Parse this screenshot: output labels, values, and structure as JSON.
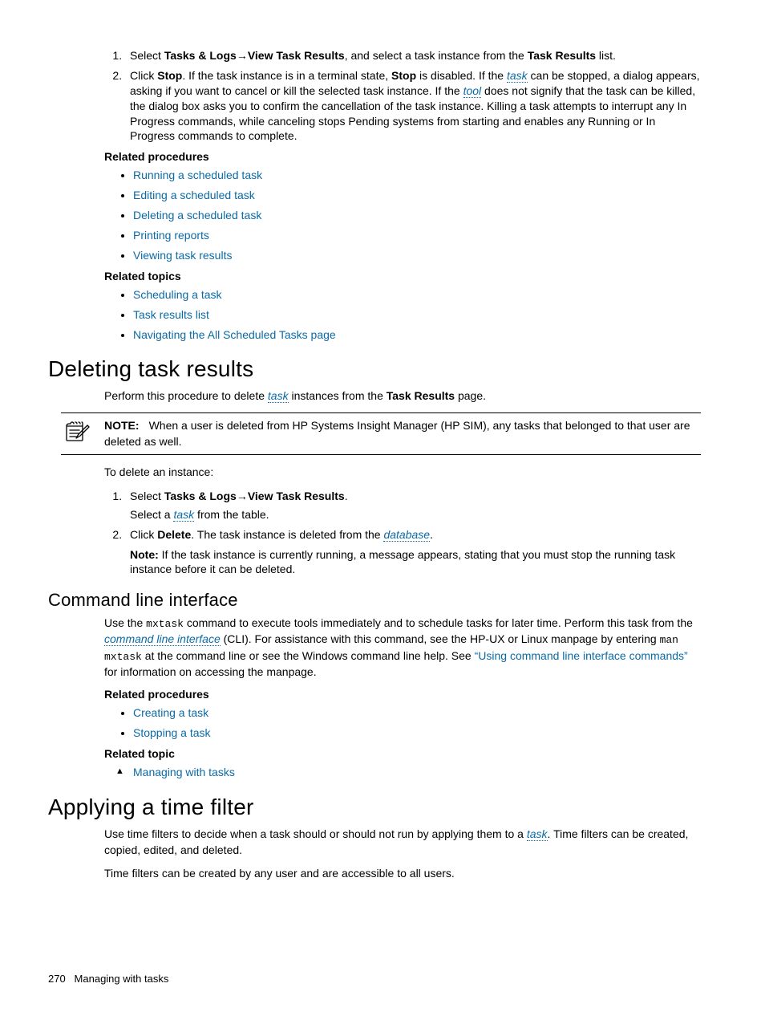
{
  "ol1": {
    "item1": {
      "pre": "Select ",
      "b1": "Tasks & Logs",
      "arrow": "→",
      "b2": "View Task Results",
      "mid": ", and select a task instance from the ",
      "b3": "Task Results",
      "post": " list."
    },
    "item2": {
      "t1": "Click ",
      "b1": "Stop",
      "t2": ". If the task instance is in a terminal state, ",
      "b2": "Stop",
      "t3": " is disabled. If the ",
      "l1": "task",
      "t4": " can be stopped, a dialog appears, asking if you want to cancel or kill the selected task instance. If the ",
      "l2": "tool",
      "t5": " does not signify that the task can be killed, the dialog box asks you to confirm the cancellation of the task instance. Killing a task attempts to interrupt any In Progress commands, while canceling stops Pending systems from starting and enables any Running or In Progress commands to complete."
    }
  },
  "relproc1_head": "Related procedures",
  "relproc1": {
    "i1": "Running a scheduled task",
    "i2": "Editing a scheduled task",
    "i3": "Deleting a scheduled task",
    "i4": "Printing reports",
    "i5": "Viewing task results"
  },
  "reltopics1_head": "Related topics",
  "reltopics1": {
    "i1": "Scheduling a task",
    "i2": "Task results list",
    "i3": "Navigating the All Scheduled Tasks page"
  },
  "sec_del_title": "Deleting task results",
  "sec_del_intro": {
    "t1": "Perform this procedure to delete ",
    "l1": "task",
    "t2": " instances from the ",
    "b1": "Task Results",
    "t3": " page."
  },
  "note1": {
    "label": "NOTE:",
    "text": "When a user is deleted from HP Systems Insight Manager (HP SIM), any tasks that belonged to that user are deleted as well."
  },
  "del_pre": "To delete an instance:",
  "ol2": {
    "item1": {
      "line1": {
        "t1": "Select ",
        "b1": "Tasks & Logs",
        "arrow": "→",
        "b2": "View Task Results",
        "t2": "."
      },
      "line2": {
        "t1": "Select a ",
        "l1": "task",
        "t2": " from the table."
      }
    },
    "item2": {
      "line1": {
        "t1": "Click ",
        "b1": "Delete",
        "t2": ". The task instance is deleted from the ",
        "l1": "database",
        "t3": "."
      },
      "line2": {
        "b1": "Note:",
        "t1": " If the task instance is currently running, a message appears, stating that you must stop the running task instance before it can be deleted."
      }
    }
  },
  "sec_cli_title": "Command line interface",
  "cli_para": {
    "t1": "Use the ",
    "m1": "mxtask",
    "t2": " command to execute tools immediately and to schedule tasks for later time. Perform this task from the ",
    "l1": "command line interface",
    "t3": " (CLI). For assistance with this command, see the HP-UX or Linux manpage by entering ",
    "m2": "man mxtask",
    "t4": " at the command line or see the Windows command line help. See ",
    "q1": "“Using command line interface commands”",
    "t5": " for information on accessing the manpage."
  },
  "relproc2_head": "Related procedures",
  "relproc2": {
    "i1": "Creating a task",
    "i2": "Stopping a task"
  },
  "reltopic2_head": "Related topic",
  "reltopic2": {
    "i1": "Managing with tasks"
  },
  "sec_time_title": "Applying a time filter",
  "time_p1": {
    "t1": "Use time filters to decide when a task should or should not run by applying them to a ",
    "l1": "task",
    "t2": ". Time filters can be created, copied, edited, and deleted."
  },
  "time_p2": "Time filters can be created by any user and are accessible to all users.",
  "footer": {
    "page": "270",
    "title": "Managing with tasks"
  }
}
